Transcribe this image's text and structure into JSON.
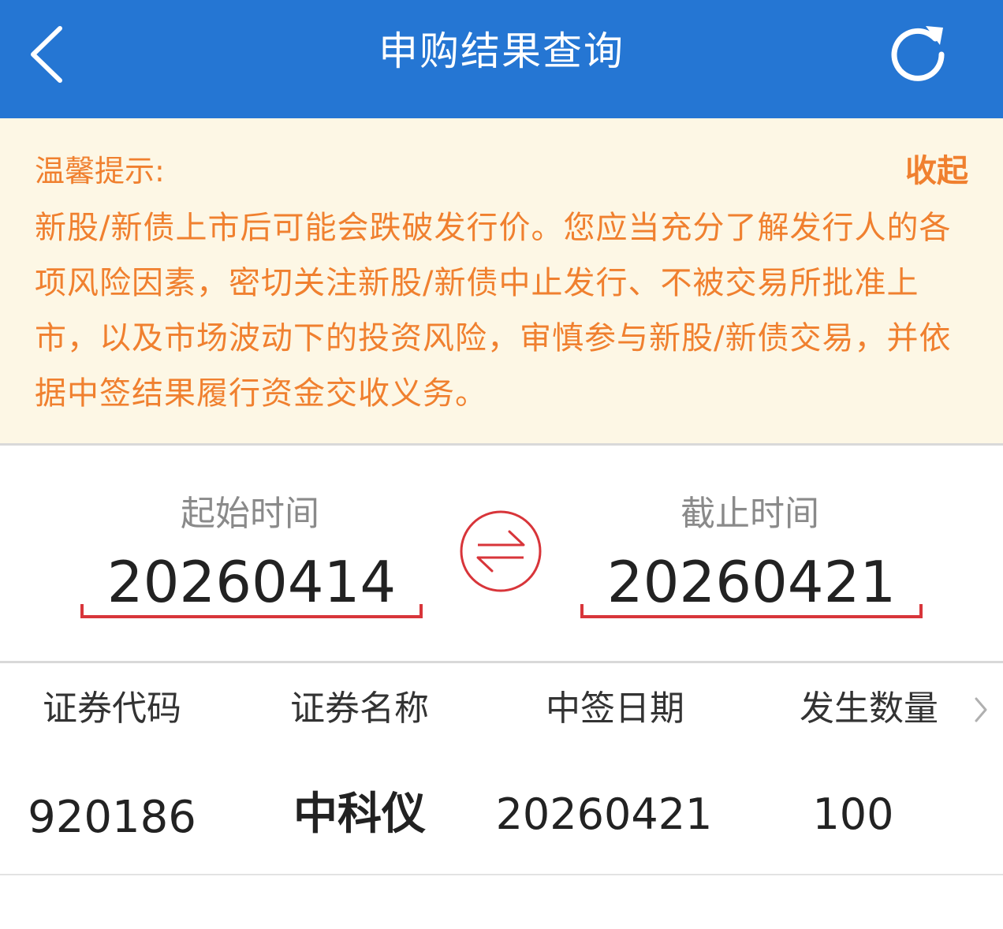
{
  "header": {
    "title": "申购结果查询",
    "back_icon": "chevron-left-icon",
    "refresh_icon": "refresh-icon"
  },
  "notice": {
    "title": "温馨提示:",
    "collapse_label": "收起",
    "body": "新股/新债上市后可能会跌破发行价。您应当充分了解发行人的各项风险因素，密切关注新股/新债中止发行、不被交易所批准上市，以及市场波动下的投资风险，审慎参与新股/新债交易，并依据中签结果履行资金交收义务。"
  },
  "date_range": {
    "start_label": "起始时间",
    "start_value": "20260414",
    "end_label": "截止时间",
    "end_value": "20260421",
    "swap_icon": "swap-arrows-icon"
  },
  "table": {
    "columns": [
      "证券代码",
      "证券名称",
      "中签日期",
      "发生数量"
    ],
    "more_icon": "chevron-right-icon",
    "rows": [
      {
        "code": "920186",
        "name": "中科仪",
        "date": "20260421",
        "quantity": "100"
      }
    ]
  },
  "colors": {
    "header_bg": "#2576d3",
    "notice_bg": "#fdf7e5",
    "notice_text": "#f0802f",
    "accent_red": "#d8353a"
  }
}
